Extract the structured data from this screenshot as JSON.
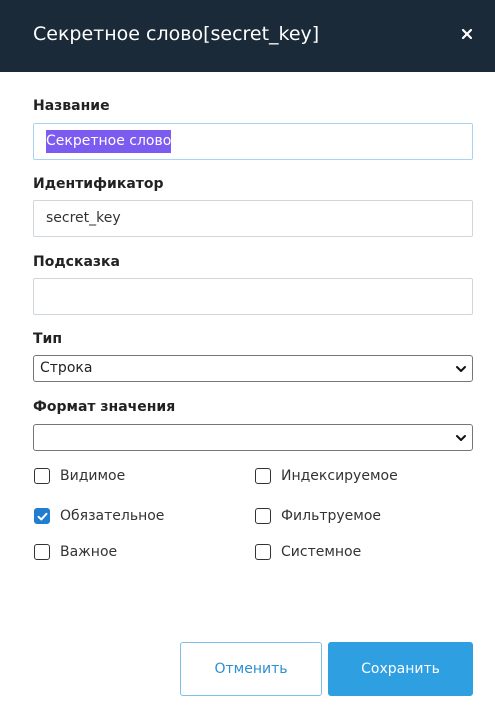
{
  "dialog": {
    "title": "Секретное слово[secret_key]",
    "close_icon": "close-icon"
  },
  "fields": {
    "name": {
      "label": "Название",
      "value": "Секретное слово"
    },
    "identifier": {
      "label": "Идентификатор",
      "value": "secret_key"
    },
    "hint": {
      "label": "Подсказка",
      "value": ""
    },
    "type": {
      "label": "Тип",
      "value": "Строка"
    },
    "format": {
      "label": "Формат значения",
      "value": ""
    }
  },
  "checkboxes": {
    "visible": {
      "label": "Видимое",
      "checked": false
    },
    "indexed": {
      "label": "Индексируемое",
      "checked": false
    },
    "required": {
      "label": "Обязательное",
      "checked": true
    },
    "filtered": {
      "label": "Фильтруемое",
      "checked": false
    },
    "important": {
      "label": "Важное",
      "checked": false
    },
    "system": {
      "label": "Системное",
      "checked": false
    }
  },
  "buttons": {
    "cancel": "Отменить",
    "save": "Сохранить"
  },
  "colors": {
    "header_bg": "#1b2a38",
    "accent": "#2e9fe0",
    "checkbox_checked": "#1f7ed0",
    "selection": "#7c5cf0"
  }
}
